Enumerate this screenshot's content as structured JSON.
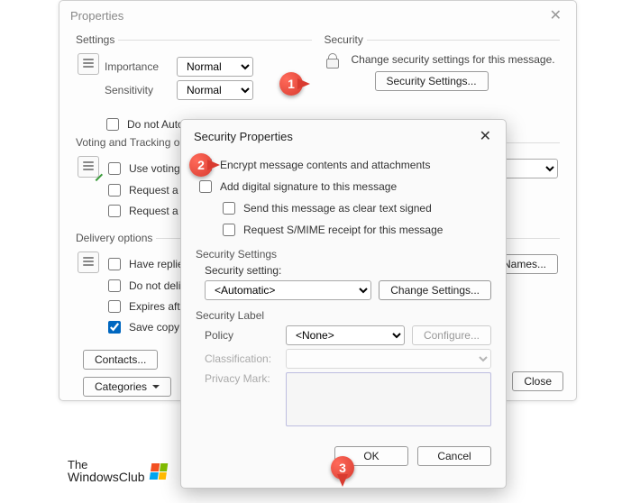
{
  "properties": {
    "title": "Properties",
    "settings_legend": "Settings",
    "importance_label": "Importance",
    "importance_value": "Normal",
    "sensitivity_label": "Sensitivity",
    "sensitivity_value": "Normal",
    "autoarchive": "Do not AutoArchive this item",
    "security_legend": "Security",
    "security_text": "Change security settings for this message.",
    "security_button": "Security Settings...",
    "voting_legend": "Voting and Tracking options",
    "voting_use": "Use voting buttons",
    "voting_delivery": "Request a delivery receipt",
    "voting_read": "Request a read receipt",
    "delivery_legend": "Delivery options",
    "delivery_replies": "Have replies sent to",
    "delivery_select_names": "Select Names...",
    "delivery_deliver_before": "Do not deliver before",
    "delivery_expires": "Expires after",
    "delivery_save": "Save copy of sent message",
    "contacts_btn": "Contacts...",
    "categories_btn": "Categories",
    "close_btn": "Close"
  },
  "security": {
    "title": "Security Properties",
    "encrypt": "Encrypt message contents and attachments",
    "sign": "Add digital signature to this message",
    "cleartext": "Send this message as clear text signed",
    "smime": "Request S/MIME receipt for this message",
    "settings_legend": "Security Settings",
    "setting_label": "Security setting:",
    "setting_value": "<Automatic>",
    "change_btn": "Change Settings...",
    "label_legend": "Security Label",
    "policy_label": "Policy",
    "policy_value": "<None>",
    "configure_btn": "Configure...",
    "classification_label": "Classification:",
    "privacy_label": "Privacy Mark:",
    "ok_btn": "OK",
    "cancel_btn": "Cancel"
  },
  "annotations": {
    "a1": "1",
    "a2": "2",
    "a3": "3"
  },
  "brand": {
    "line1": "The",
    "line2": "WindowsClub"
  }
}
